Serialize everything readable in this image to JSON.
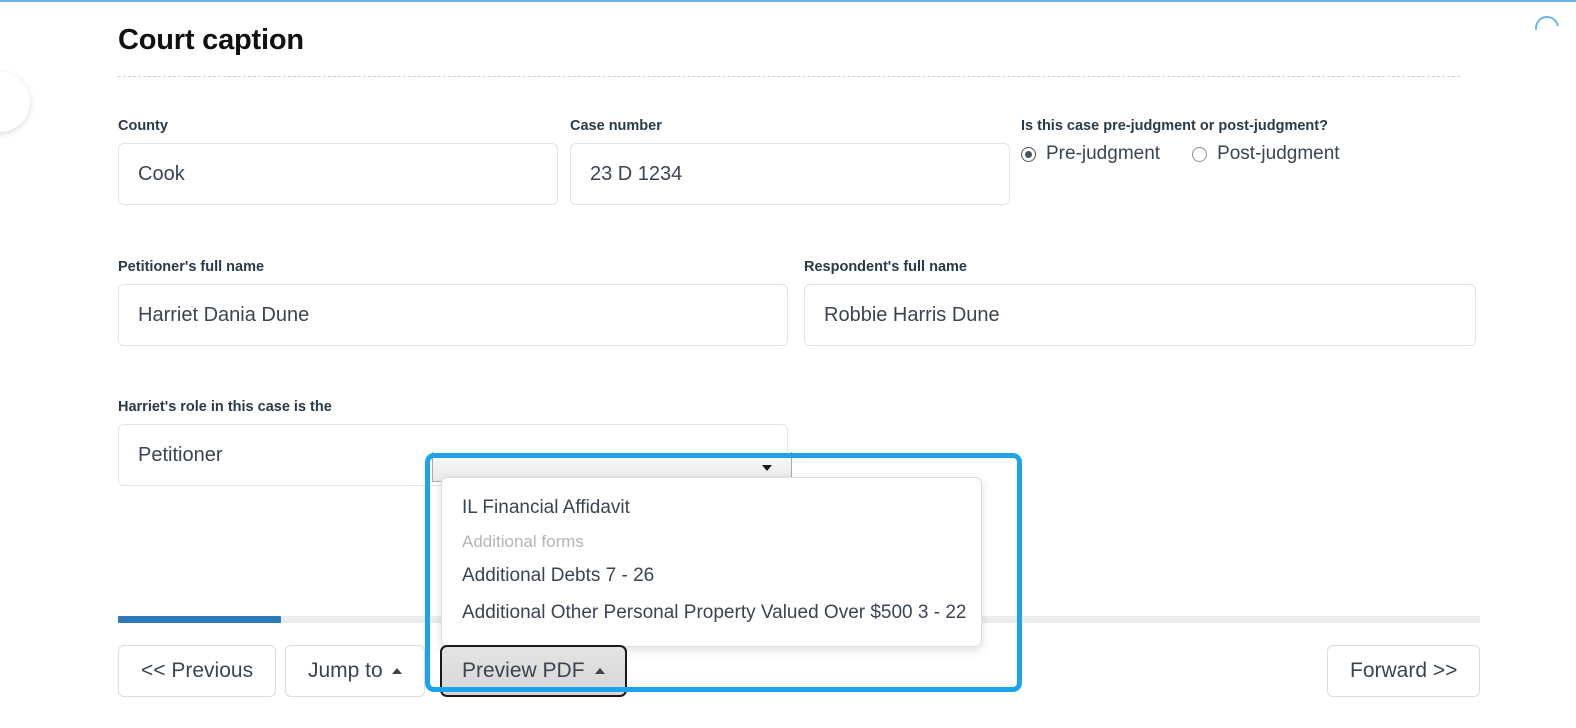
{
  "header": {
    "title": "Court caption",
    "spinner_icon": "loading-spinner-icon",
    "edge_button_icon": "circle-edge-button-icon"
  },
  "form": {
    "county": {
      "label": "County",
      "value": "Cook",
      "placeholder": ""
    },
    "case_number": {
      "label": "Case number",
      "value": "23 D 1234",
      "placeholder": ""
    },
    "judgment": {
      "label": "Is this case pre-judgment or post-judgment?",
      "options": [
        {
          "label": "Pre-judgment",
          "selected": true
        },
        {
          "label": "Post-judgment",
          "selected": false
        }
      ]
    },
    "petitioner": {
      "label": "Petitioner's full name",
      "value": "Harriet Dania Dune",
      "placeholder": ""
    },
    "respondent": {
      "label": "Respondent's full name",
      "value": "Robbie Harris Dune",
      "placeholder": ""
    },
    "role": {
      "label": "Harriet's role in this case is the",
      "value": "Petitioner",
      "caret_icon": "chevron-down-icon"
    }
  },
  "native_select": {
    "value": "",
    "caret_icon": "dropdown-triangle-icon"
  },
  "preview_dropdown": {
    "items": [
      {
        "label": "IL Financial Affidavit",
        "type": "item"
      },
      {
        "label": "Additional forms",
        "type": "group"
      },
      {
        "label": "Additional Debts 7 - 26",
        "type": "item"
      },
      {
        "label": "Additional Other Personal Property Valued Over $500 3 - 22",
        "type": "item"
      }
    ]
  },
  "footer": {
    "progress_percent": 12,
    "previous_label": "<< Previous",
    "jump_to_label": "Jump to",
    "jump_to_caret_icon": "caret-up-icon",
    "preview_pdf_label": "Preview PDF",
    "preview_pdf_caret_icon": "caret-up-icon",
    "forward_label": "Forward >>"
  },
  "colors": {
    "accent_blue": "#1ca3ec",
    "progress_blue": "#2e7ab8",
    "spinner_blue": "#6cb6e8",
    "label_navy": "#2b3a47",
    "text_gray": "#3b4550",
    "muted_gray": "#b4b4b4"
  }
}
